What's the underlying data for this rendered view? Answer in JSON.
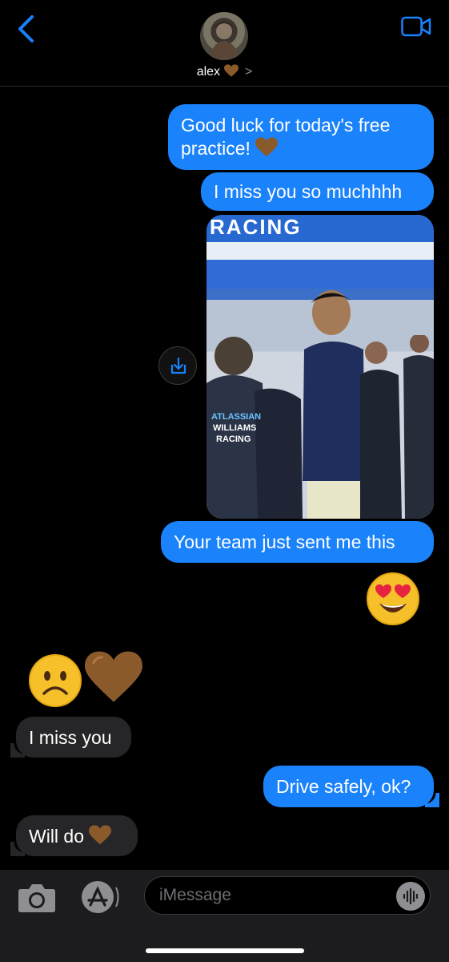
{
  "header": {
    "contact_name": "alex",
    "icons": {
      "back": "chevron-left-icon",
      "video": "video-camera-icon",
      "heart": "brown-heart-icon",
      "chevron": "chevron-right-icon"
    },
    "accent_color": "#1a82fb"
  },
  "messages": [
    {
      "from": "me",
      "text": "Good luck for today's free practice!",
      "emoji": "brown-heart"
    },
    {
      "from": "me",
      "text": "I miss you so muchhhh"
    },
    {
      "from": "me",
      "type": "photo",
      "photo_text": [
        "RACING",
        "ATLASSIAN",
        "WILLIAMS",
        "RACING"
      ]
    },
    {
      "from": "me",
      "text": "Your team just sent me this"
    },
    {
      "from": "me",
      "type": "emoji",
      "emoji": "heart-eyes"
    },
    {
      "from": "them",
      "type": "emoji",
      "emoji": "frowning-face, brown-heart"
    },
    {
      "from": "them",
      "text": "I miss you"
    },
    {
      "from": "me",
      "text": "Drive safely, ok?"
    },
    {
      "from": "them",
      "text": "Will do",
      "emoji": "brown-heart"
    }
  ],
  "composer": {
    "placeholder": "iMessage",
    "icons": {
      "camera": "camera-icon",
      "apps": "app-store-icon",
      "audio": "waveform-icon",
      "save": "save-image-icon"
    }
  },
  "colors": {
    "outgoing": "#1a82fb",
    "incoming": "#262628",
    "background": "#000000"
  }
}
